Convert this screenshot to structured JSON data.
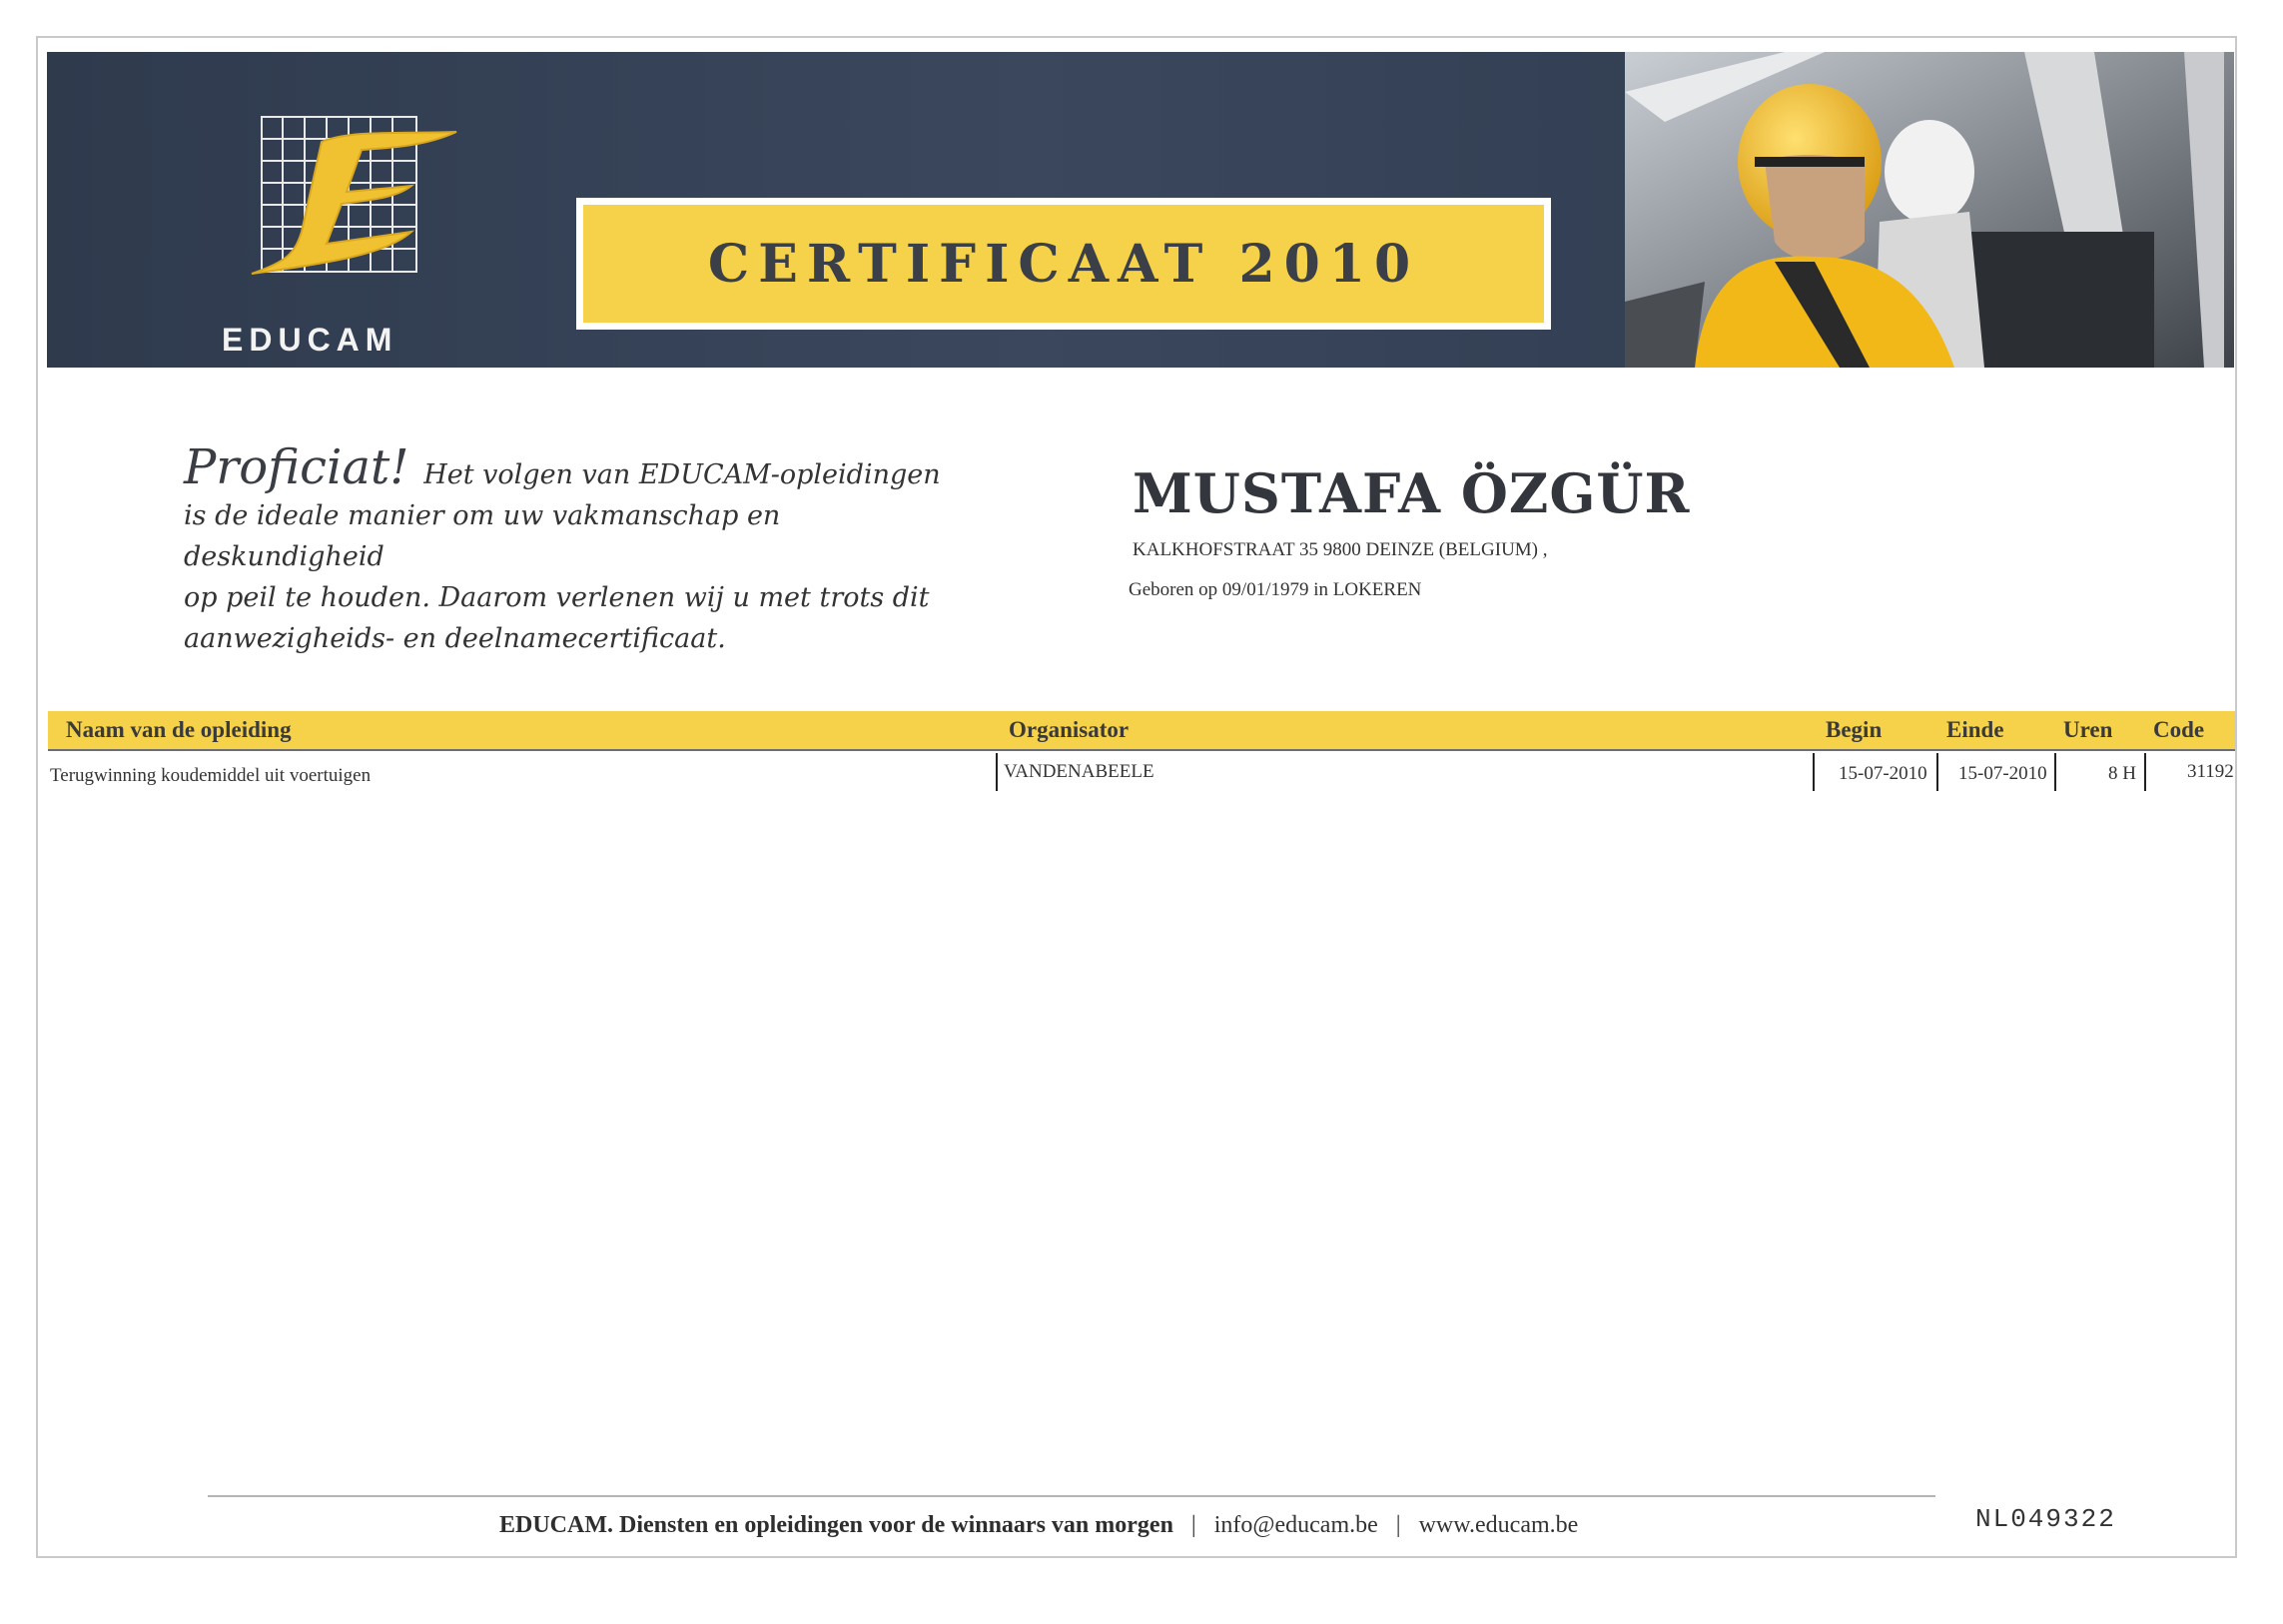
{
  "header": {
    "logo_text": "EDUCAM",
    "title": "CERTIFICAAT 2010"
  },
  "intro": {
    "exclaim": "Proficiat!",
    "line1": "Het volgen van EDUCAM-opleidingen",
    "line2": "is de ideale manier om uw vakmanschap en deskundigheid",
    "line3": "op peil te houden. Daarom verlenen wij u met trots dit",
    "line4": "aanwezigheids- en deelnamecertificaat."
  },
  "recipient": {
    "name": "MUSTAFA ÖZGÜR",
    "address": "KALKHOFSTRAAT 35  9800 DEINZE (BELGIUM) ,",
    "born": "Geboren op 09/01/1979 in LOKEREN"
  },
  "table": {
    "headers": [
      "Naam van de opleiding",
      "Organisator",
      "Begin",
      "Einde",
      "Uren",
      "Code"
    ],
    "rows": [
      [
        "Terugwinning koudemiddel uit voertuigen",
        "VANDENABEELE",
        "15-07-2010",
        "15-07-2010",
        "8 H",
        "31192"
      ]
    ]
  },
  "footer": {
    "tagline": "EDUCAM. Diensten en opleidingen voor de winnaars van morgen",
    "email": "info@educam.be",
    "web": "www.educam.be",
    "sep": "|",
    "doc_number": "NL049322"
  },
  "colors": {
    "accent_yellow": "#f5d24a",
    "banner_blue": "#34405a"
  }
}
